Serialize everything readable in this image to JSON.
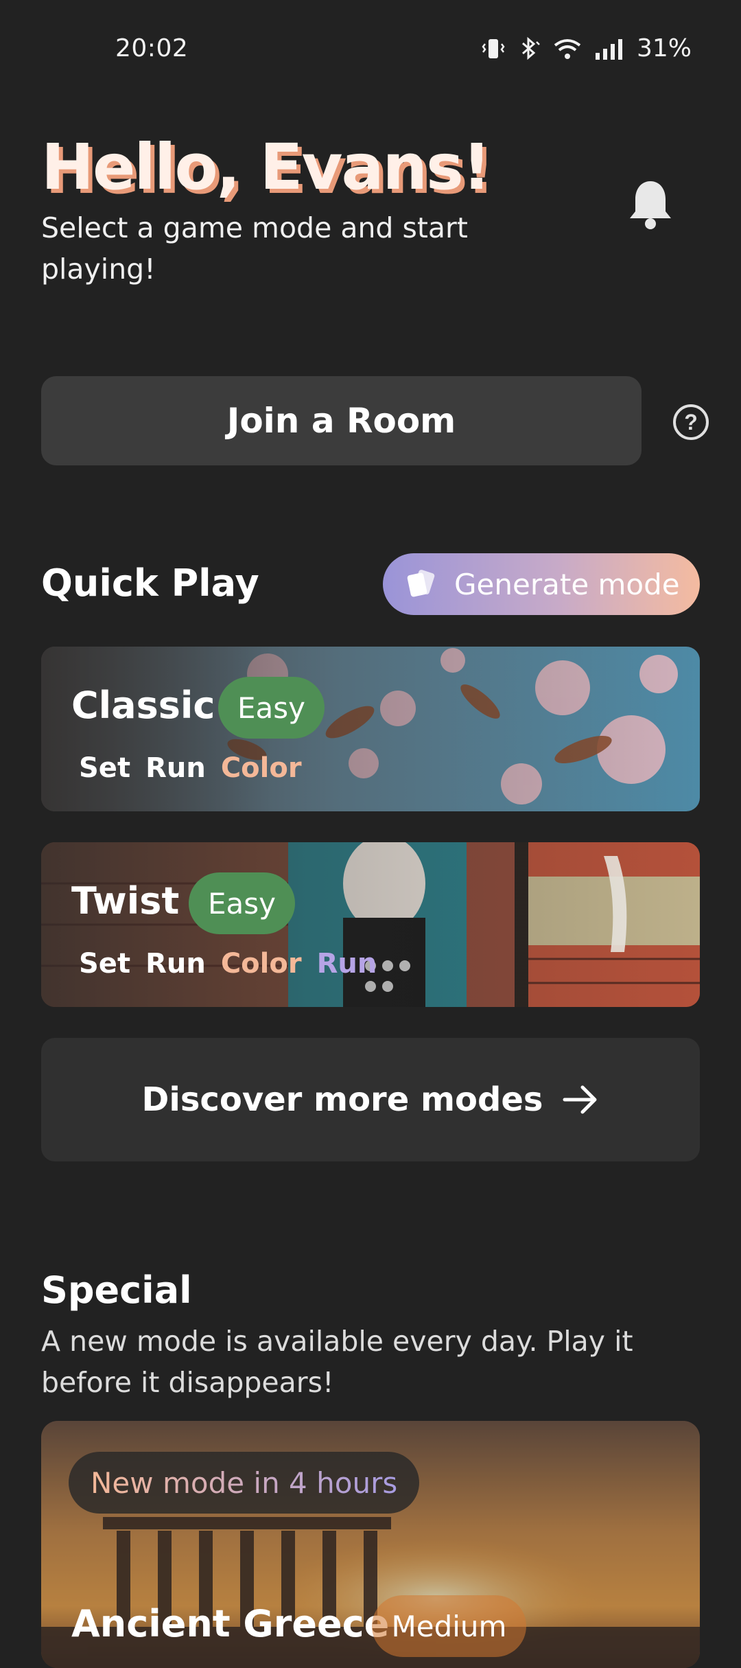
{
  "status_bar": {
    "time": "20:02",
    "battery": "31%",
    "icons": [
      "vibrate-icon",
      "bluetooth-icon",
      "wifi-icon",
      "signal-icon"
    ]
  },
  "header": {
    "greeting": "Hello, Evans!",
    "subtitle": "Select a game mode and start playing!"
  },
  "join": {
    "label": "Join a Room"
  },
  "quick_play": {
    "title": "Quick Play",
    "generate_label": "Generate mode",
    "modes": [
      {
        "title": "Classic",
        "difficulty": "Easy",
        "tags": [
          {
            "text": "Set",
            "color": "#ffffff"
          },
          {
            "text": "Run",
            "color": "#ffffff"
          },
          {
            "text": "Color",
            "color": "#f4b898"
          }
        ]
      },
      {
        "title": "Twist",
        "difficulty": "Easy",
        "tags": [
          {
            "text": "Set",
            "color": "#ffffff"
          },
          {
            "text": "Run",
            "color": "#ffffff"
          },
          {
            "text": "Color",
            "color": "#f4b898"
          },
          {
            "text": "Run",
            "color": "#b6a4e6"
          }
        ]
      }
    ],
    "discover_label": "Discover more modes"
  },
  "special": {
    "title": "Special",
    "description": "A new mode is available every day. Play it before it disappears!",
    "card": {
      "countdown": "New mode in 4 hours",
      "title": "Ancient Greece",
      "difficulty": "Medium"
    }
  },
  "colors": {
    "background": "#222222",
    "accent_green": "#4f8f55",
    "accent_peach": "#f4b898",
    "accent_lavender": "#9a94d8"
  }
}
